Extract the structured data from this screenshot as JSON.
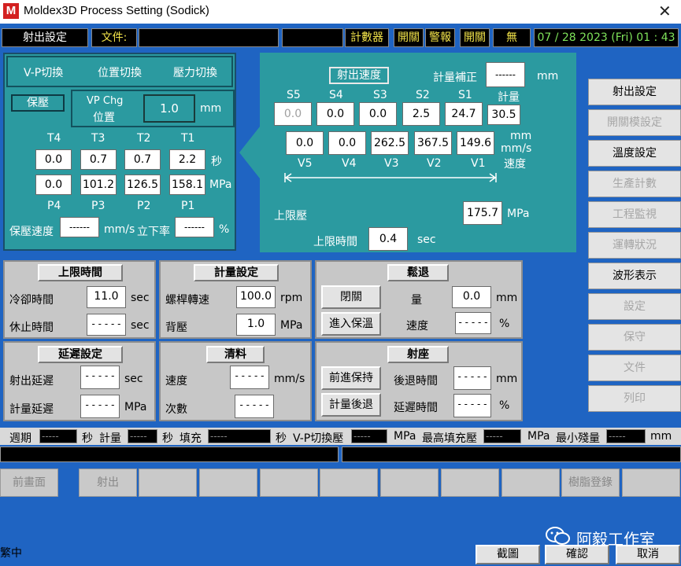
{
  "window": {
    "logo": "M",
    "title": "Moldex3D Process Setting (Sodick)",
    "close": "✕"
  },
  "status": {
    "inject_setting": "射出設定",
    "file_label": "文件:",
    "counter": "計數器",
    "toggle1": "開關",
    "alarm": "警報",
    "toggle2": "開關",
    "none": "無",
    "datetime": "07 / 28 2023 (Fri) 01 : 43"
  },
  "vp": {
    "tab_vp_switch": "V-P切換",
    "tab_pos_switch": "位置切換",
    "tab_pres_switch": "壓力切換",
    "hold_btn": "保壓",
    "vp_chg_line1": "VP Chg",
    "vp_chg_line2": "位置",
    "vp_chg_value": "1.0",
    "vp_chg_unit": "mm",
    "t_labels": [
      "T4",
      "T3",
      "T2",
      "T1"
    ],
    "t_values": [
      "0.0",
      "0.7",
      "0.7",
      "2.2"
    ],
    "t_unit": "秒",
    "p_values": [
      "0.0",
      "101.2",
      "126.5",
      "158.1"
    ],
    "p_unit": "MPa",
    "p_labels": [
      "P4",
      "P3",
      "P2",
      "P1"
    ],
    "hold_speed_label": "保壓速度",
    "hold_speed_value": "------",
    "hold_speed_unit": "mm/s",
    "rise_label": "立下率",
    "rise_value": "------",
    "rise_unit": "%"
  },
  "injection": {
    "speed_btn": "射出速度",
    "metering_comp_label": "計量補正",
    "metering_comp_value": "------",
    "metering_comp_unit": "mm",
    "s_labels": [
      "S5",
      "S4",
      "S3",
      "S2",
      "S1"
    ],
    "s_values": [
      "0.0",
      "0.0",
      "0.0",
      "2.5",
      "24.7"
    ],
    "metering_label": "計量",
    "metering_value": "30.5",
    "v_values": [
      "0.0",
      "0.0",
      "262.5",
      "367.5",
      "149.6"
    ],
    "v_labels": [
      "V5",
      "V4",
      "V3",
      "V2",
      "V1"
    ],
    "v_unit_mm": "mm",
    "v_unit_mms": "mm/s",
    "v_unit_speed": "速度",
    "upper_pressure_label": "上限壓",
    "upper_pressure_value": "175.7",
    "upper_pressure_unit": "MPa",
    "upper_time_label": "上限時間",
    "upper_time_value": "0.4",
    "upper_time_unit": "sec"
  },
  "sidebar": {
    "items": [
      {
        "label": "射出設定",
        "enabled": true
      },
      {
        "label": "開關模設定",
        "enabled": false
      },
      {
        "label": "溫度設定",
        "enabled": true
      },
      {
        "label": "生產計數",
        "enabled": false
      },
      {
        "label": "工程監視",
        "enabled": false
      },
      {
        "label": "運轉狀況",
        "enabled": false
      },
      {
        "label": "波形表示",
        "enabled": true
      },
      {
        "label": "設定",
        "enabled": false
      },
      {
        "label": "保守",
        "enabled": false
      },
      {
        "label": "文件",
        "enabled": false
      },
      {
        "label": "列印",
        "enabled": false
      }
    ]
  },
  "limit_time": {
    "title": "上限時間",
    "cool_label": "冷卻時間",
    "cool_value": "11.0",
    "cool_unit": "sec",
    "pause_label": "休止時間",
    "pause_value": "- - - - -",
    "pause_unit": "sec"
  },
  "metering": {
    "title": "計量設定",
    "screw_label": "螺桿轉速",
    "screw_value": "100.0",
    "screw_unit": "rpm",
    "back_label": "背壓",
    "back_value": "1.0",
    "back_unit": "MPa"
  },
  "decompress": {
    "title": "鬆退",
    "toggle_btn": "閉關",
    "enter_hold_btn": "進入保溫",
    "amount_label": "量",
    "amount_value": "0.0",
    "amount_unit": "mm",
    "speed_label": "速度",
    "speed_value": "- - - - -",
    "speed_unit": "%"
  },
  "delay": {
    "title": "延遲設定",
    "inject_label": "射出延遲",
    "inject_value": "- - - - -",
    "inject_unit": "sec",
    "meter_label": "計量延遲",
    "meter_value": "- - - - -",
    "meter_unit": "MPa"
  },
  "purge": {
    "title": "清料",
    "speed_label": "速度",
    "speed_value": "- - - - -",
    "speed_unit": "mm/s",
    "count_label": "次數",
    "count_value": "- - - - -"
  },
  "nozzle": {
    "title": "射座",
    "forward_btn": "前進保持",
    "retract_btn": "計量後退",
    "back_time_label": "後退時間",
    "back_time_value": "- - - - -",
    "back_time_unit": "mm",
    "delay_label": "延遲時間",
    "delay_value": "- - - - -",
    "delay_unit": "%"
  },
  "monitor": {
    "cycle_label": "週期",
    "cycle_value": "-----",
    "cycle_unit": "秒",
    "meter_label": "計量",
    "meter_value": "-----",
    "meter_unit": "秒",
    "fill_label": "填充",
    "fill_value": "-----",
    "fill_unit": "秒",
    "vp_label": "V-P切換壓",
    "vp_value": "-----",
    "vp_unit": "MPa",
    "max_fill_label": "最高填充壓",
    "max_fill_value": "-----",
    "max_fill_unit": "MPa",
    "min_cushion_label": "最小殘量",
    "min_cushion_value": "-----",
    "min_cushion_unit": "mm"
  },
  "bottom": {
    "prev_screen": "前畫面",
    "inject": "射出",
    "resin_register": "樹脂登錄",
    "status_text": "繁中",
    "zoom": "截圖",
    "confirm": "確認",
    "cancel": "取消",
    "watermark": "阿毅工作室"
  }
}
